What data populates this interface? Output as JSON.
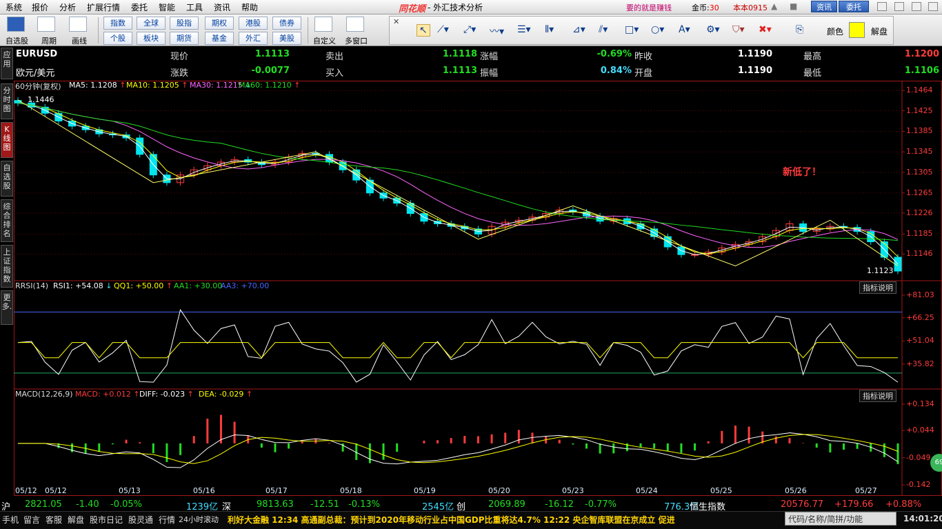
{
  "menu": [
    "系统",
    "报价",
    "分析",
    "扩展行情",
    "委托",
    "智能",
    "工具",
    "资讯",
    "帮助"
  ],
  "app": {
    "title": "- 外汇技术分析",
    "logo": "同花顺",
    "slogan": "要的就是赚钱",
    "coin_label": "金币:",
    "coin_value": "30",
    "version": "本本0915",
    "btn_info": "资讯",
    "btn_trade": "委托"
  },
  "toolbar": {
    "group1": [
      "自选股",
      "周期",
      "画线"
    ],
    "market_buttons": [
      [
        "指数",
        "全球",
        "股指",
        "期权",
        "港股",
        "债券"
      ],
      [
        "个股",
        "板块",
        "期货",
        "基金",
        "外汇",
        "美股"
      ]
    ],
    "group3": [
      "自定义",
      "多窗口"
    ],
    "color_label": "颜色",
    "unlock": "解盘",
    "color_value": "#ffff00"
  },
  "sidebar": [
    "应用",
    "分时图",
    "K线图",
    "自选股",
    "综合排名",
    "上证指数",
    "更多."
  ],
  "quote": {
    "code": "EURUSD",
    "name": "欧元/美元",
    "rows": [
      [
        {
          "l": "现价",
          "v": "1.1113",
          "c": "green"
        },
        {
          "l": "卖出",
          "v": "1.1118",
          "c": "green"
        },
        {
          "l": "涨幅",
          "v": "-0.69%",
          "c": "green"
        },
        {
          "l": "昨收",
          "v": "1.1190",
          "c": "white"
        },
        {
          "l": "最高",
          "v": "1.1200",
          "c": "red"
        }
      ],
      [
        {
          "l": "涨跌",
          "v": "-0.0077",
          "c": "green"
        },
        {
          "l": "买入",
          "v": "1.1113",
          "c": "green"
        },
        {
          "l": "振幅",
          "v": "0.84%",
          "c": "cyan"
        },
        {
          "l": "开盘",
          "v": "1.1190",
          "c": "white"
        },
        {
          "l": "最低",
          "v": "1.1106",
          "c": "green"
        }
      ]
    ]
  },
  "main_chart": {
    "period": "60分钟(复权)",
    "ma": [
      {
        "label": "MA5: 1.1208",
        "arrow": "↑",
        "color": "#ffffff"
      },
      {
        "label": "MA10: 1.1205",
        "arrow": "↑",
        "color": "#ffff00"
      },
      {
        "label": "MA30: 1.1215",
        "arrow": "↓",
        "color": "#ff66ff"
      },
      {
        "label": "MA60: 1.1210",
        "arrow": "↑",
        "color": "#22dd22"
      }
    ],
    "annotation": "新低了！",
    "high_label": "1.1446",
    "low_label": "1.1123"
  },
  "rsi_panel": {
    "title": "RRSI(14)",
    "labels": [
      {
        "t": "RSI1: +54.08",
        "a": "↓",
        "color": "#ffffff"
      },
      {
        "t": "QQ1: +50.00",
        "a": "↑",
        "color": "#ffff00"
      },
      {
        "t": "AA1: +30.00",
        "a": "",
        "color": "#22dd22"
      },
      {
        "t": "AA3: +70.00",
        "a": "",
        "color": "#4466ff"
      }
    ],
    "explain": "指标说明"
  },
  "macd_panel": {
    "title": "MACD(12,26,9)",
    "labels": [
      {
        "t": "MACD: +0.012",
        "a": "↑",
        "color": "#ff3b3b"
      },
      {
        "t": "DIFF: -0.023",
        "a": "↑",
        "color": "#ffffff"
      },
      {
        "t": "DEA: -0.029",
        "a": "↑",
        "color": "#ffff00"
      }
    ],
    "explain": "指标说明"
  },
  "dates": [
    "05/12",
    "05/12",
    "05/13",
    "05/16",
    "05/17",
    "05/18",
    "05/19",
    "05/20",
    "05/23",
    "05/24",
    "05/25",
    "05/26",
    "05/27"
  ],
  "status": [
    {
      "t": "沪",
      "c": "white"
    },
    {
      "t": "2821.05",
      "c": "green"
    },
    {
      "t": "-1.40",
      "c": "green"
    },
    {
      "t": "-0.05%",
      "c": "green"
    },
    {
      "t": "1239亿",
      "c": "cyan"
    },
    {
      "t": "深",
      "c": "white"
    },
    {
      "t": "9813.63",
      "c": "green"
    },
    {
      "t": "-12.51",
      "c": "green"
    },
    {
      "t": "-0.13%",
      "c": "green"
    },
    {
      "t": "2545亿",
      "c": "cyan"
    },
    {
      "t": "创",
      "c": "white"
    },
    {
      "t": "2069.89",
      "c": "green"
    },
    {
      "t": "-16.12",
      "c": "green"
    },
    {
      "t": "-0.77%",
      "c": "green"
    },
    {
      "t": "776.3亿",
      "c": "cyan"
    },
    {
      "t": "恒生指数",
      "c": "white"
    },
    {
      "t": "20576.77",
      "c": "red"
    },
    {
      "t": "+179.66",
      "c": "red"
    },
    {
      "t": "+0.88%",
      "c": "red"
    }
  ],
  "bottom": {
    "items": [
      "手机",
      "留言",
      "客服",
      "解盘",
      "股市日记",
      "股灵通",
      "行情",
      "24小时滚动"
    ],
    "ticker": "利好大金融      12:34 高通副总裁：预计到2020年移动行业占中国GDP比重将达4.7%                   12:22 央企智库联盟在京成立 促进",
    "search": "代码/名称/简拼/功能",
    "clock": "14:01:20",
    "badge": "69"
  },
  "chart_data": {
    "type": "line",
    "symbol": "EURUSD",
    "period": "60分钟",
    "price_axis": {
      "ticks": [
        1.1464,
        1.1425,
        1.1385,
        1.1345,
        1.1305,
        1.1265,
        1.1226,
        1.1185,
        1.1146
      ],
      "ylim": [
        1.1105,
        1.147
      ]
    },
    "ma_values": {
      "MA5": 1.1208,
      "MA10": 1.1205,
      "MA30": 1.1215,
      "MA60": 1.121
    },
    "close_approx": [
      1.144,
      1.1432,
      1.142,
      1.1405,
      1.1395,
      1.1388,
      1.138,
      1.1378,
      1.1372,
      1.134,
      1.13,
      1.1285,
      1.13,
      1.131,
      1.1318,
      1.1325,
      1.133,
      1.1325,
      1.132,
      1.1325,
      1.1335,
      1.1342,
      1.134,
      1.1325,
      1.131,
      1.129,
      1.1265,
      1.1255,
      1.1245,
      1.1225,
      1.121,
      1.1205,
      1.12,
      1.1195,
      1.1185,
      1.12,
      1.1208,
      1.1212,
      1.1218,
      1.1225,
      1.1232,
      1.1228,
      1.122,
      1.121,
      1.1215,
      1.1205,
      1.1195,
      1.118,
      1.116,
      1.1145,
      1.1145,
      1.115,
      1.1158,
      1.1165,
      1.117,
      1.118,
      1.1192,
      1.1205,
      1.119,
      1.1195,
      1.12,
      1.1198,
      1.119,
      1.117,
      1.114,
      1.1113
    ],
    "rsi_axis": {
      "ticks": [
        81.03,
        66.25,
        51.04,
        35.82
      ],
      "levels": {
        "AA1": 30,
        "QQ1": 50,
        "AA3": 70
      }
    },
    "macd_axis": {
      "ticks": [
        0.134,
        0.044,
        -0.049,
        -0.142
      ]
    }
  }
}
